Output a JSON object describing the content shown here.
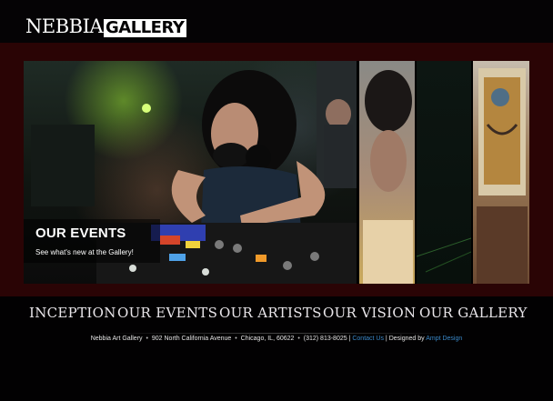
{
  "header": {
    "logo_part1": "NEBBIA",
    "logo_part2": "GALLERY"
  },
  "slideshow": {
    "caption_title": "OUR EVENTS",
    "caption_subtitle": "See what's new at the Gallery!"
  },
  "nav": {
    "items": [
      "INCEPTION",
      "OUR EVENTS",
      "OUR ARTISTS",
      "OUR VISION",
      "OUR GALLERY"
    ]
  },
  "footer": {
    "name": "Nebbia Art Gallery",
    "address": "902 North California Avenue",
    "city": "Chicago, IL, 60622",
    "phone": "(312) 813-8025",
    "contact_link": "Contact Us",
    "designed_by_prefix": "Designed by",
    "designer_link": "Ampt Design"
  },
  "colors": {
    "background": "#020102",
    "band": "#2a0405",
    "link": "#3a88c8"
  }
}
